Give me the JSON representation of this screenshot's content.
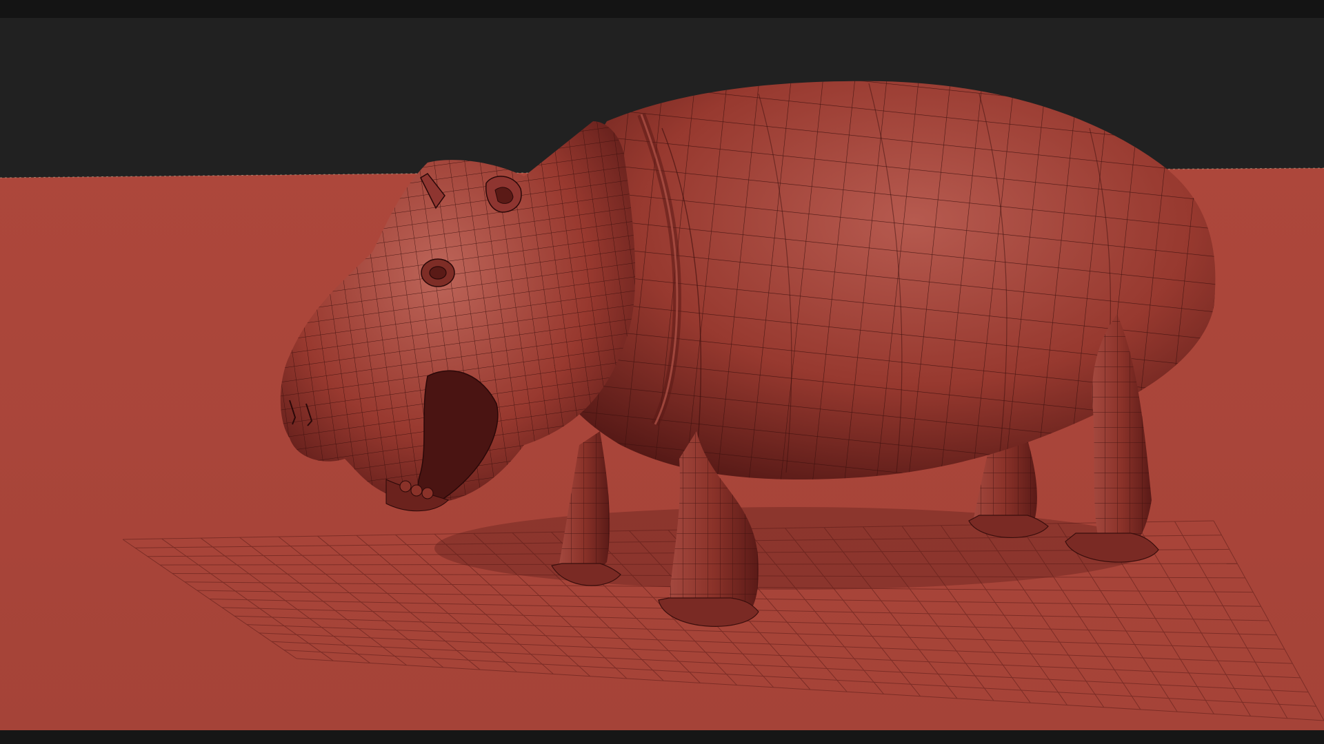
{
  "colors": {
    "chrome_dark": "#141414",
    "backdrop": "#222222",
    "floor": "#a8453a",
    "mesh_base": "#9c3f36",
    "mesh_highlight": "#c06a5e",
    "mesh_shadow": "#4a1412",
    "wire": "#3a0e0c",
    "grid": "#6e2620"
  },
  "viewport": {
    "model_subject": "hippopotamus-wireframe-mesh",
    "floor_grid": true,
    "wireframe_overlay": true
  }
}
